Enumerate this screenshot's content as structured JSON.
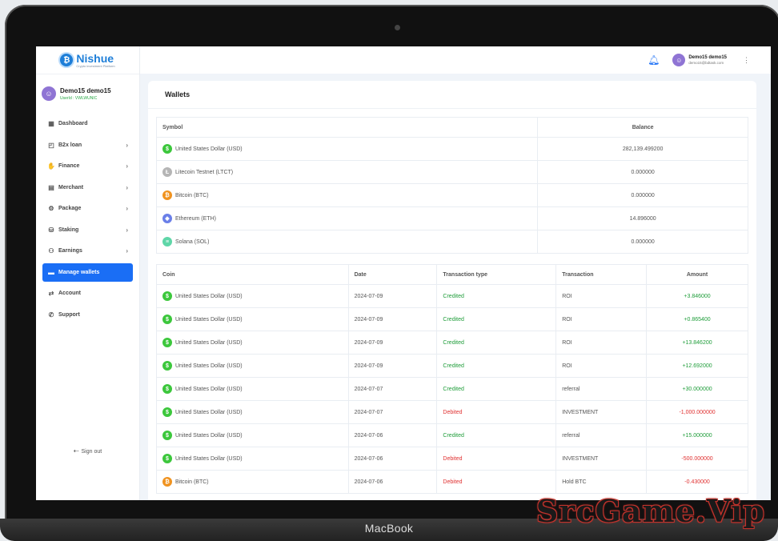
{
  "app": {
    "logo_name": "Nishue",
    "logo_tagline": "Crypto investment Platform"
  },
  "user": {
    "name": "Demo15 demo15",
    "userid_label": "UserId : VWLWUNIC",
    "email": "demo15@bdtask.com"
  },
  "sidebar": {
    "items": [
      {
        "label": "Dashboard",
        "icon": "grid-icon",
        "glyph": "▦",
        "chevron": false,
        "active": false
      },
      {
        "label": "B2x loan",
        "icon": "wallet-icon",
        "glyph": "◰",
        "chevron": true,
        "active": false
      },
      {
        "label": "Finance",
        "icon": "hand-coin-icon",
        "glyph": "✋",
        "chevron": true,
        "active": false
      },
      {
        "label": "Merchant",
        "icon": "document-icon",
        "glyph": "▤",
        "chevron": true,
        "active": false
      },
      {
        "label": "Package",
        "icon": "gear-icon",
        "glyph": "⚙",
        "chevron": true,
        "active": false
      },
      {
        "label": "Staking",
        "icon": "stack-icon",
        "glyph": "⛁",
        "chevron": true,
        "active": false
      },
      {
        "label": "Earnings",
        "icon": "earnings-icon",
        "glyph": "⚇",
        "chevron": true,
        "active": false
      },
      {
        "label": "Manage wallets",
        "icon": "wallet-card-icon",
        "glyph": "▬",
        "chevron": false,
        "active": true
      },
      {
        "label": "Account",
        "icon": "transfer-icon",
        "glyph": "⇄",
        "chevron": false,
        "active": false
      },
      {
        "label": "Support",
        "icon": "phone-icon",
        "glyph": "✆",
        "chevron": false,
        "active": false
      }
    ],
    "signout_label": "Sign out"
  },
  "page": {
    "title": "Wallets"
  },
  "wallets": {
    "headers": {
      "symbol": "Symbol",
      "balance": "Balance"
    },
    "rows": [
      {
        "name": "United States Dollar (USD)",
        "balance": "282,139.499200",
        "glyph": "$",
        "color": "#3cc73c"
      },
      {
        "name": "Litecoin Testnet (LTCT)",
        "balance": "0.000000",
        "glyph": "Ł",
        "color": "#b5b5b5"
      },
      {
        "name": "Bitcoin (BTC)",
        "balance": "0.000000",
        "glyph": "₿",
        "color": "#f09320"
      },
      {
        "name": "Ethereum (ETH)",
        "balance": "14.896000",
        "glyph": "◆",
        "color": "#6a7fe8"
      },
      {
        "name": "Solana (SOL)",
        "balance": "0.000000",
        "glyph": "≡",
        "color": "#5fd6a8"
      }
    ]
  },
  "transactions": {
    "headers": {
      "coin": "Coin",
      "date": "Date",
      "type": "Transaction type",
      "transaction": "Transaction",
      "amount": "Amount"
    },
    "rows": [
      {
        "coin": "United States Dollar (USD)",
        "glyph": "$",
        "color": "#3cc73c",
        "date": "2024-07-09",
        "type": "Credited",
        "transaction": "ROI",
        "amount": "+3.846000"
      },
      {
        "coin": "United States Dollar (USD)",
        "glyph": "$",
        "color": "#3cc73c",
        "date": "2024-07-09",
        "type": "Credited",
        "transaction": "ROI",
        "amount": "+0.865400"
      },
      {
        "coin": "United States Dollar (USD)",
        "glyph": "$",
        "color": "#3cc73c",
        "date": "2024-07-09",
        "type": "Credited",
        "transaction": "ROI",
        "amount": "+13.846200"
      },
      {
        "coin": "United States Dollar (USD)",
        "glyph": "$",
        "color": "#3cc73c",
        "date": "2024-07-09",
        "type": "Credited",
        "transaction": "ROI",
        "amount": "+12.692000"
      },
      {
        "coin": "United States Dollar (USD)",
        "glyph": "$",
        "color": "#3cc73c",
        "date": "2024-07-07",
        "type": "Credited",
        "transaction": "referral",
        "amount": "+30.000000"
      },
      {
        "coin": "United States Dollar (USD)",
        "glyph": "$",
        "color": "#3cc73c",
        "date": "2024-07-07",
        "type": "Debited",
        "transaction": "INVESTMENT",
        "amount": "-1,000.000000"
      },
      {
        "coin": "United States Dollar (USD)",
        "glyph": "$",
        "color": "#3cc73c",
        "date": "2024-07-06",
        "type": "Credited",
        "transaction": "referral",
        "amount": "+15.000000"
      },
      {
        "coin": "United States Dollar (USD)",
        "glyph": "$",
        "color": "#3cc73c",
        "date": "2024-07-06",
        "type": "Debited",
        "transaction": "INVESTMENT",
        "amount": "-500.000000"
      },
      {
        "coin": "Bitcoin (BTC)",
        "glyph": "₿",
        "color": "#f09320",
        "date": "2024-07-06",
        "type": "Debited",
        "transaction": "Hold BTC",
        "amount": "-0.430000"
      }
    ]
  },
  "device": {
    "brand": "MacBook",
    "watermark": "SrcGame.Vip"
  },
  "colors": {
    "accent": "#1a6ef5",
    "credit": "#1f9d3a",
    "debit": "#e03131"
  }
}
